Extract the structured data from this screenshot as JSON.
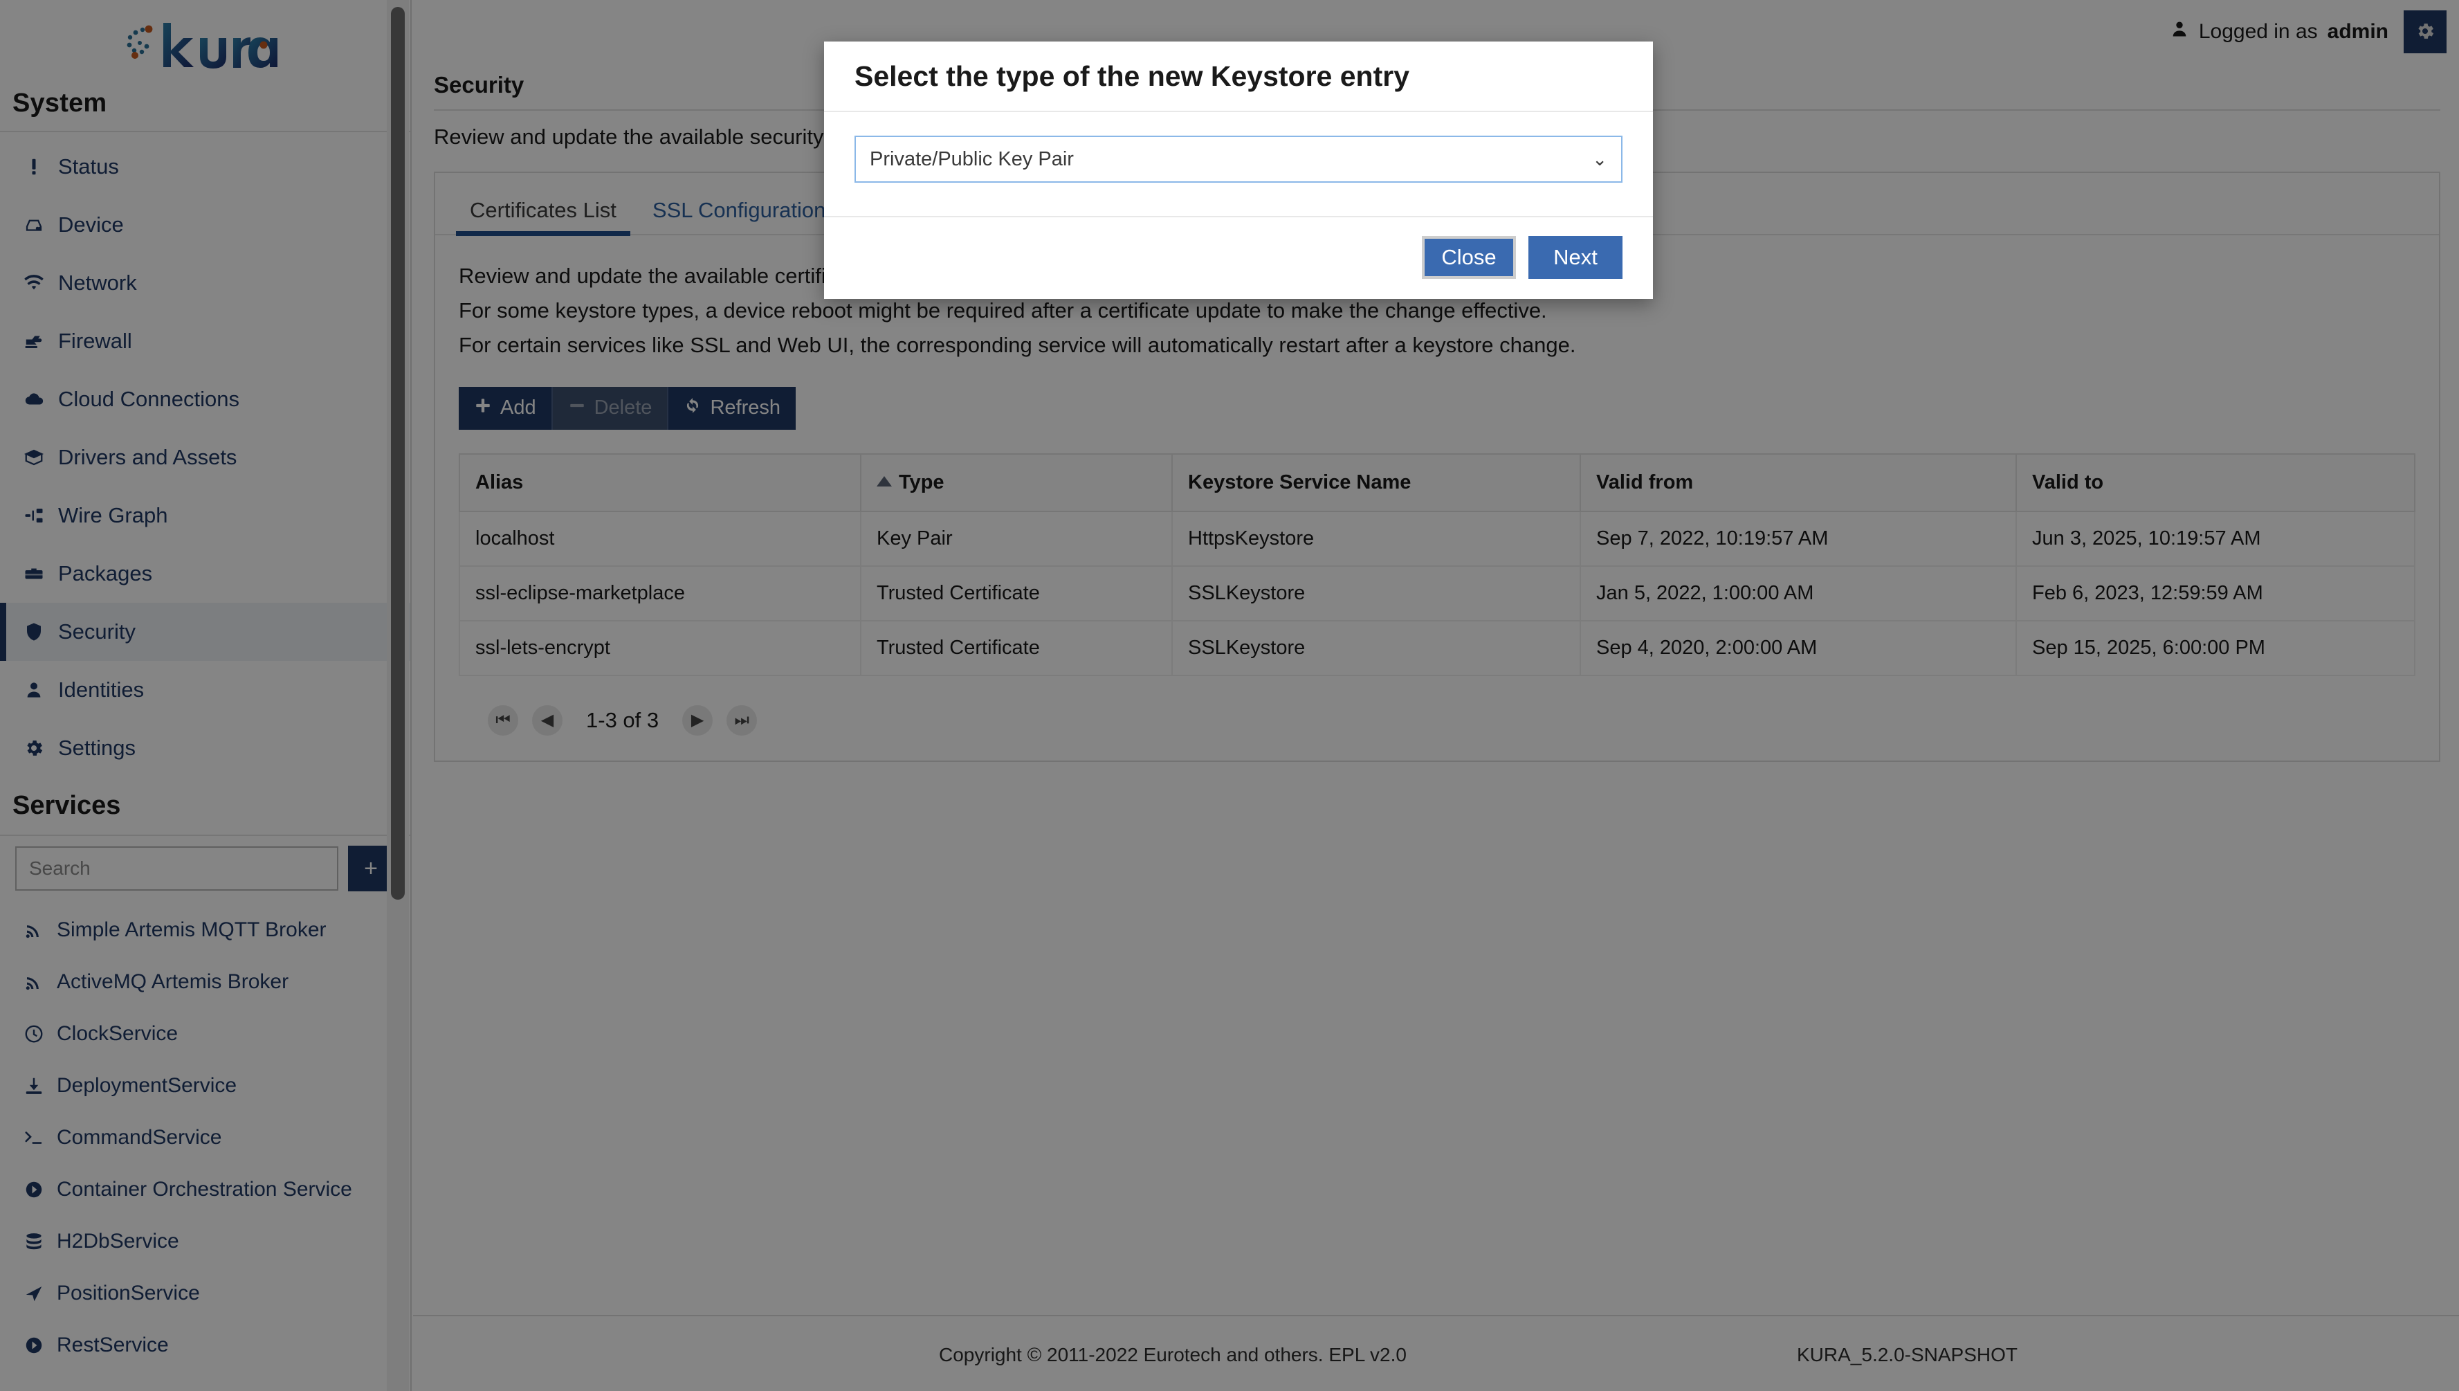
{
  "app": {
    "logo_text": "kura",
    "version_footer": "KURA_5.2.0-SNAPSHOT",
    "copyright": "Copyright © 2011-2022 Eurotech and others. EPL v2.0"
  },
  "topbar": {
    "user_icon": "user-icon",
    "logged_in_prefix": "Logged in as",
    "username": "admin",
    "settings_icon": "gear-icon"
  },
  "sidebar": {
    "system_heading": "System",
    "services_heading": "Services",
    "search": {
      "placeholder": "Search",
      "value": ""
    },
    "add_button_label": "+",
    "system_items": [
      {
        "label": "Status",
        "icon": "exclamation-icon",
        "active": false
      },
      {
        "label": "Device",
        "icon": "device-icon",
        "active": false
      },
      {
        "label": "Network",
        "icon": "wifi-icon",
        "active": false
      },
      {
        "label": "Firewall",
        "icon": "firewall-icon",
        "active": false
      },
      {
        "label": "Cloud Connections",
        "icon": "cloud-icon",
        "active": false
      },
      {
        "label": "Drivers and Assets",
        "icon": "box-icon",
        "active": false
      },
      {
        "label": "Wire Graph",
        "icon": "wire-graph-icon",
        "active": false
      },
      {
        "label": "Packages",
        "icon": "briefcase-icon",
        "active": false
      },
      {
        "label": "Security",
        "icon": "shield-icon",
        "active": true
      },
      {
        "label": "Identities",
        "icon": "person-icon",
        "active": false
      },
      {
        "label": "Settings",
        "icon": "gear-icon",
        "active": false
      }
    ],
    "service_items": [
      {
        "label": "Simple Artemis MQTT Broker",
        "icon": "broadcast-icon"
      },
      {
        "label": "ActiveMQ Artemis Broker",
        "icon": "broadcast-icon"
      },
      {
        "label": "ClockService",
        "icon": "clock-icon"
      },
      {
        "label": "DeploymentService",
        "icon": "download-icon"
      },
      {
        "label": "CommandService",
        "icon": "terminal-icon"
      },
      {
        "label": "Container Orchestration Service",
        "icon": "arrow-circle-icon"
      },
      {
        "label": "H2DbService",
        "icon": "database-icon"
      },
      {
        "label": "PositionService",
        "icon": "navigation-icon"
      },
      {
        "label": "RestService",
        "icon": "arrow-circle-icon"
      }
    ]
  },
  "page": {
    "title": "Security",
    "subtitle": "Review and update the available security settings."
  },
  "tabs": [
    {
      "label": "Certificates List",
      "active": true
    },
    {
      "label": "SSL Configuration",
      "active": false
    }
  ],
  "panel": {
    "desc_lines": [
      "Review and update the available certificates.",
      "For some keystore types, a device reboot might be required after a certificate update to make the change effective.",
      "For certain services like SSL and Web UI, the corresponding service will automatically restart after a keystore change."
    ],
    "toolbar": [
      {
        "label": "Add",
        "icon": "plus-icon",
        "disabled": false
      },
      {
        "label": "Delete",
        "icon": "minus-icon",
        "disabled": true
      },
      {
        "label": "Refresh",
        "icon": "refresh-icon",
        "disabled": false
      }
    ]
  },
  "table": {
    "columns": [
      {
        "label": "Alias",
        "sorted": false
      },
      {
        "label": "Type",
        "sorted": true,
        "direction": "asc"
      },
      {
        "label": "Keystore Service Name",
        "sorted": false
      },
      {
        "label": "Valid from",
        "sorted": false
      },
      {
        "label": "Valid to",
        "sorted": false
      }
    ],
    "rows": [
      {
        "alias": "localhost",
        "type": "Key Pair",
        "keystore": "HttpsKeystore",
        "valid_from": "Sep 7, 2022, 10:19:57 AM",
        "valid_to": "Jun 3, 2025, 10:19:57 AM"
      },
      {
        "alias": "ssl-eclipse-marketplace",
        "type": "Trusted Certificate",
        "keystore": "SSLKeystore",
        "valid_from": "Jan 5, 2022, 1:00:00 AM",
        "valid_to": "Feb 6, 2023, 12:59:59 AM"
      },
      {
        "alias": "ssl-lets-encrypt",
        "type": "Trusted Certificate",
        "keystore": "SSLKeystore",
        "valid_from": "Sep 4, 2020, 2:00:00 AM",
        "valid_to": "Sep 15, 2025, 6:00:00 PM"
      }
    ]
  },
  "pagination": {
    "first_icon": "first-page-icon",
    "prev_icon": "prev-page-icon",
    "next_icon": "next-page-icon",
    "last_icon": "last-page-icon",
    "range_label": "1-3 of 3"
  },
  "modal": {
    "title": "Select the type of the new Keystore entry",
    "select": {
      "value": "Private/Public Key Pair",
      "caret_icon": "chevron-down-icon"
    },
    "close_label": "Close",
    "next_label": "Next",
    "accent_color": "#3a6ab0"
  }
}
